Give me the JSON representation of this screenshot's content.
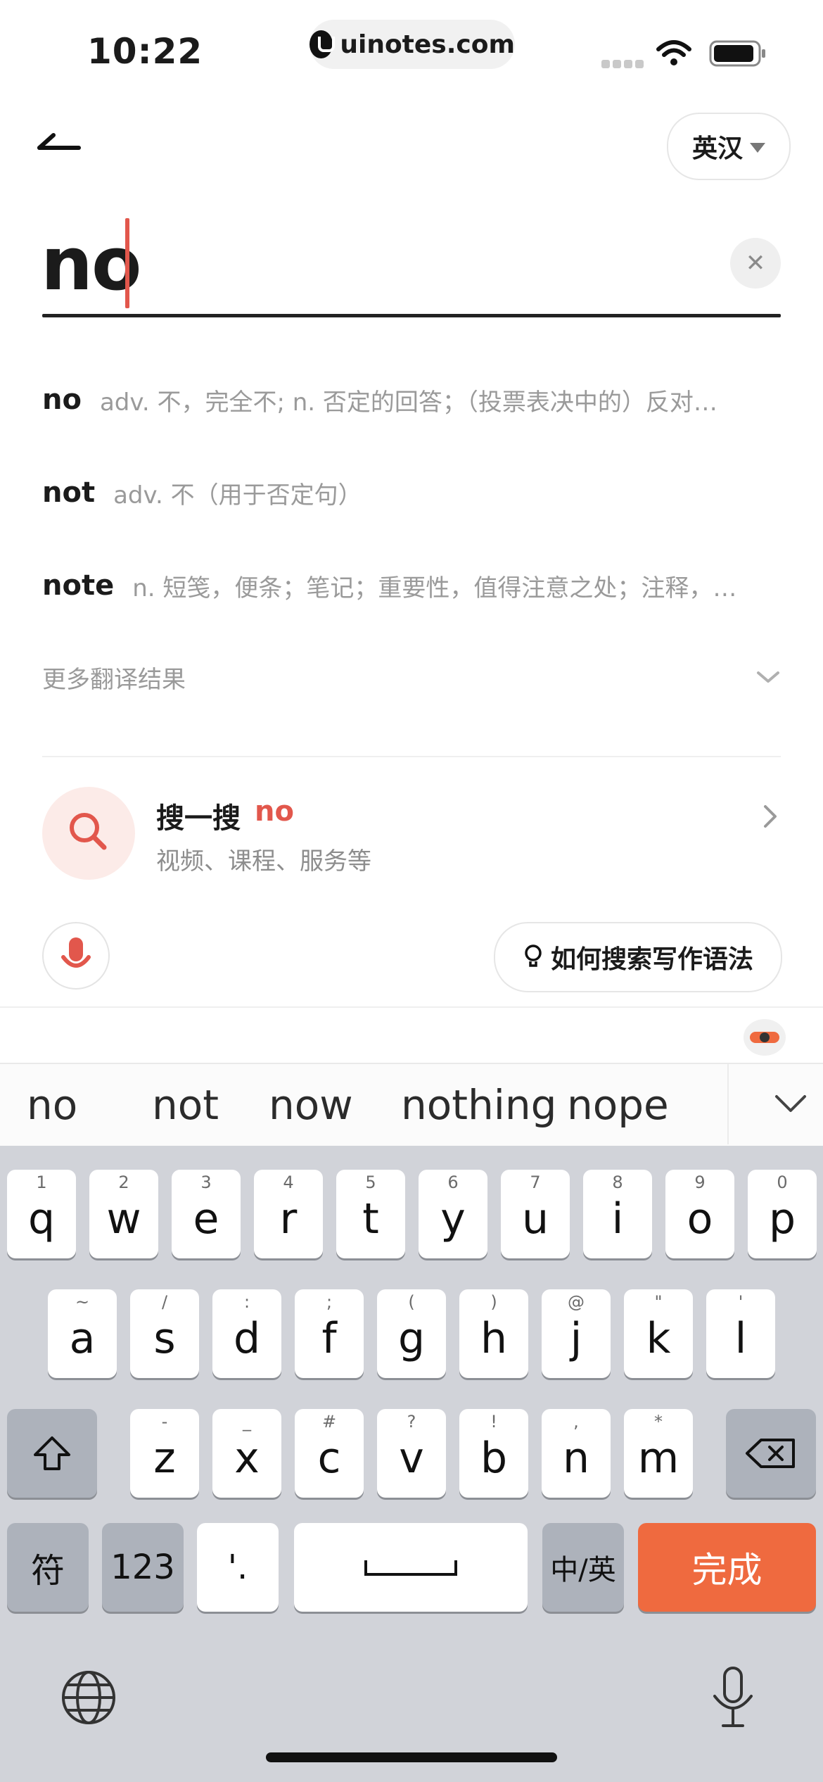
{
  "status_bar": {
    "time": "10:22",
    "url": "uinotes.com"
  },
  "header": {
    "lang_label": "英汉"
  },
  "search": {
    "query": "no",
    "clear_symbol": "✕"
  },
  "suggestions": [
    {
      "word": "no",
      "definition": "adv. 不，完全不; n. 否定的回答；（投票表决中的）反对…"
    },
    {
      "word": "not",
      "definition": "adv. 不（用于否定句）"
    },
    {
      "word": "note",
      "definition": "n. 短笺，便条；笔记；重要性，值得注意之处；注释，…"
    }
  ],
  "more_results": "更多翻译结果",
  "search_card": {
    "title": "搜一搜",
    "keyword": "no",
    "subtitle": "视频、课程、服务等"
  },
  "howto_label": "如何搜索写作语法",
  "predictions": [
    "no",
    "not",
    "now",
    "nothing",
    "nope"
  ],
  "keyboard": {
    "row1": [
      {
        "hint": "1",
        "key": "q"
      },
      {
        "hint": "2",
        "key": "w"
      },
      {
        "hint": "3",
        "key": "e"
      },
      {
        "hint": "4",
        "key": "r"
      },
      {
        "hint": "5",
        "key": "t"
      },
      {
        "hint": "6",
        "key": "y"
      },
      {
        "hint": "7",
        "key": "u"
      },
      {
        "hint": "8",
        "key": "i"
      },
      {
        "hint": "9",
        "key": "o"
      },
      {
        "hint": "0",
        "key": "p"
      }
    ],
    "row2": [
      {
        "hint": "~",
        "key": "a"
      },
      {
        "hint": "/",
        "key": "s"
      },
      {
        "hint": ":",
        "key": "d"
      },
      {
        "hint": ";",
        "key": "f"
      },
      {
        "hint": "(",
        "key": "g"
      },
      {
        "hint": ")",
        "key": "h"
      },
      {
        "hint": "@",
        "key": "j"
      },
      {
        "hint": "\"",
        "key": "k"
      },
      {
        "hint": "'",
        "key": "l"
      }
    ],
    "row3": [
      {
        "hint": "-",
        "key": "z"
      },
      {
        "hint": "_",
        "key": "x"
      },
      {
        "hint": "#",
        "key": "c"
      },
      {
        "hint": "?",
        "key": "v"
      },
      {
        "hint": "!",
        "key": "b"
      },
      {
        "hint": ",",
        "key": "n"
      },
      {
        "hint": "*",
        "key": "m"
      }
    ],
    "symbols_key": "符",
    "numbers_key": "123",
    "punct_key": "'.",
    "lang_switch_key": "中/英",
    "done_key": "完成"
  },
  "colors": {
    "accent": "#e2574c",
    "done": "#ef6a3f",
    "keyboard_bg": "#d1d3d9"
  }
}
